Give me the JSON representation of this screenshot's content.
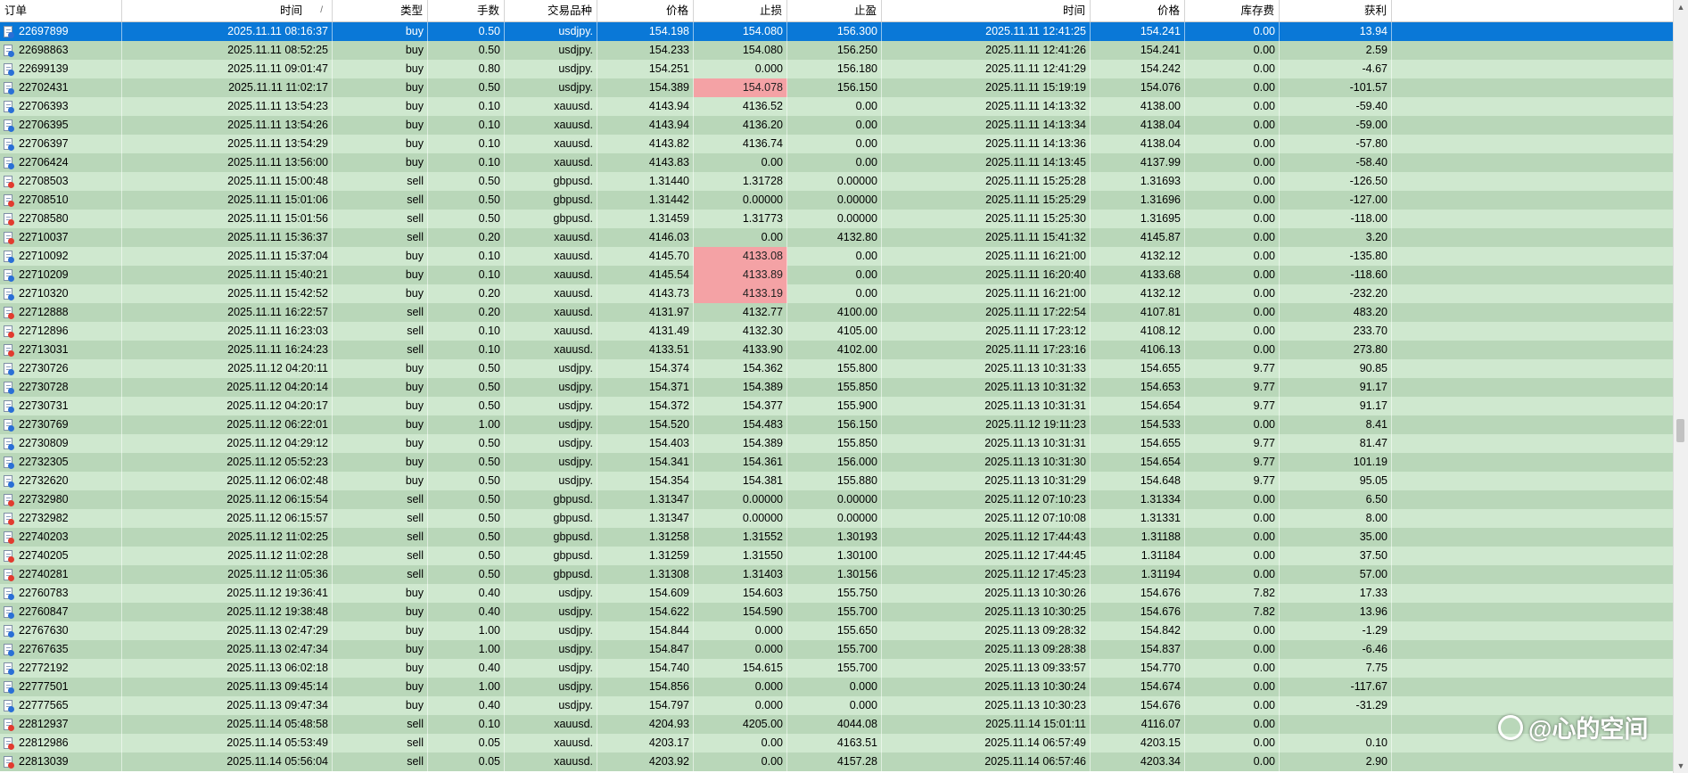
{
  "columns": [
    "订单",
    "时间",
    "类型",
    "手数",
    "交易品种",
    "价格",
    "止损",
    "止盈",
    "时间",
    "价格",
    "库存费",
    "获利"
  ],
  "sort_indicator": "/",
  "rows": [
    {
      "order": "22697899",
      "open_time": "2025.11.11 08:16:37",
      "type": "buy",
      "lots": "0.50",
      "symbol": "usdjpy.",
      "open_price": "154.198",
      "sl": "154.080",
      "tp": "156.300",
      "close_time": "2025.11.11 12:41:25",
      "close_price": "154.241",
      "swap": "0.00",
      "profit": "13.94",
      "selected": true
    },
    {
      "order": "22698863",
      "open_time": "2025.11.11 08:52:25",
      "type": "buy",
      "lots": "0.50",
      "symbol": "usdjpy.",
      "open_price": "154.233",
      "sl": "154.080",
      "tp": "156.250",
      "close_time": "2025.11.11 12:41:26",
      "close_price": "154.241",
      "swap": "0.00",
      "profit": "2.59"
    },
    {
      "order": "22699139",
      "open_time": "2025.11.11 09:01:47",
      "type": "buy",
      "lots": "0.80",
      "symbol": "usdjpy.",
      "open_price": "154.251",
      "sl": "0.000",
      "tp": "156.180",
      "close_time": "2025.11.11 12:41:29",
      "close_price": "154.242",
      "swap": "0.00",
      "profit": "-4.67"
    },
    {
      "order": "22702431",
      "open_time": "2025.11.11 11:02:17",
      "type": "buy",
      "lots": "0.50",
      "symbol": "usdjpy.",
      "open_price": "154.389",
      "sl": "154.078",
      "tp": "156.150",
      "close_time": "2025.11.11 15:19:19",
      "close_price": "154.076",
      "swap": "0.00",
      "profit": "-101.57",
      "sl_hit": true
    },
    {
      "order": "22706393",
      "open_time": "2025.11.11 13:54:23",
      "type": "buy",
      "lots": "0.10",
      "symbol": "xauusd.",
      "open_price": "4143.94",
      "sl": "4136.52",
      "tp": "0.00",
      "close_time": "2025.11.11 14:13:32",
      "close_price": "4138.00",
      "swap": "0.00",
      "profit": "-59.40"
    },
    {
      "order": "22706395",
      "open_time": "2025.11.11 13:54:26",
      "type": "buy",
      "lots": "0.10",
      "symbol": "xauusd.",
      "open_price": "4143.94",
      "sl": "4136.20",
      "tp": "0.00",
      "close_time": "2025.11.11 14:13:34",
      "close_price": "4138.04",
      "swap": "0.00",
      "profit": "-59.00"
    },
    {
      "order": "22706397",
      "open_time": "2025.11.11 13:54:29",
      "type": "buy",
      "lots": "0.10",
      "symbol": "xauusd.",
      "open_price": "4143.82",
      "sl": "4136.74",
      "tp": "0.00",
      "close_time": "2025.11.11 14:13:36",
      "close_price": "4138.04",
      "swap": "0.00",
      "profit": "-57.80"
    },
    {
      "order": "22706424",
      "open_time": "2025.11.11 13:56:00",
      "type": "buy",
      "lots": "0.10",
      "symbol": "xauusd.",
      "open_price": "4143.83",
      "sl": "0.00",
      "tp": "0.00",
      "close_time": "2025.11.11 14:13:45",
      "close_price": "4137.99",
      "swap": "0.00",
      "profit": "-58.40"
    },
    {
      "order": "22708503",
      "open_time": "2025.11.11 15:00:48",
      "type": "sell",
      "lots": "0.50",
      "symbol": "gbpusd.",
      "open_price": "1.31440",
      "sl": "1.31728",
      "tp": "0.00000",
      "close_time": "2025.11.11 15:25:28",
      "close_price": "1.31693",
      "swap": "0.00",
      "profit": "-126.50"
    },
    {
      "order": "22708510",
      "open_time": "2025.11.11 15:01:06",
      "type": "sell",
      "lots": "0.50",
      "symbol": "gbpusd.",
      "open_price": "1.31442",
      "sl": "0.00000",
      "tp": "0.00000",
      "close_time": "2025.11.11 15:25:29",
      "close_price": "1.31696",
      "swap": "0.00",
      "profit": "-127.00"
    },
    {
      "order": "22708580",
      "open_time": "2025.11.11 15:01:56",
      "type": "sell",
      "lots": "0.50",
      "symbol": "gbpusd.",
      "open_price": "1.31459",
      "sl": "1.31773",
      "tp": "0.00000",
      "close_time": "2025.11.11 15:25:30",
      "close_price": "1.31695",
      "swap": "0.00",
      "profit": "-118.00"
    },
    {
      "order": "22710037",
      "open_time": "2025.11.11 15:36:37",
      "type": "sell",
      "lots": "0.20",
      "symbol": "xauusd.",
      "open_price": "4146.03",
      "sl": "0.00",
      "tp": "4132.80",
      "close_time": "2025.11.11 15:41:32",
      "close_price": "4145.87",
      "swap": "0.00",
      "profit": "3.20"
    },
    {
      "order": "22710092",
      "open_time": "2025.11.11 15:37:04",
      "type": "buy",
      "lots": "0.10",
      "symbol": "xauusd.",
      "open_price": "4145.70",
      "sl": "4133.08",
      "tp": "0.00",
      "close_time": "2025.11.11 16:21:00",
      "close_price": "4132.12",
      "swap": "0.00",
      "profit": "-135.80",
      "sl_hit": true
    },
    {
      "order": "22710209",
      "open_time": "2025.11.11 15:40:21",
      "type": "buy",
      "lots": "0.10",
      "symbol": "xauusd.",
      "open_price": "4145.54",
      "sl": "4133.89",
      "tp": "0.00",
      "close_time": "2025.11.11 16:20:40",
      "close_price": "4133.68",
      "swap": "0.00",
      "profit": "-118.60",
      "sl_hit": true
    },
    {
      "order": "22710320",
      "open_time": "2025.11.11 15:42:52",
      "type": "buy",
      "lots": "0.20",
      "symbol": "xauusd.",
      "open_price": "4143.73",
      "sl": "4133.19",
      "tp": "0.00",
      "close_time": "2025.11.11 16:21:00",
      "close_price": "4132.12",
      "swap": "0.00",
      "profit": "-232.20",
      "sl_hit": true
    },
    {
      "order": "22712888",
      "open_time": "2025.11.11 16:22:57",
      "type": "sell",
      "lots": "0.20",
      "symbol": "xauusd.",
      "open_price": "4131.97",
      "sl": "4132.77",
      "tp": "4100.00",
      "close_time": "2025.11.11 17:22:54",
      "close_price": "4107.81",
      "swap": "0.00",
      "profit": "483.20"
    },
    {
      "order": "22712896",
      "open_time": "2025.11.11 16:23:03",
      "type": "sell",
      "lots": "0.10",
      "symbol": "xauusd.",
      "open_price": "4131.49",
      "sl": "4132.30",
      "tp": "4105.00",
      "close_time": "2025.11.11 17:23:12",
      "close_price": "4108.12",
      "swap": "0.00",
      "profit": "233.70"
    },
    {
      "order": "22713031",
      "open_time": "2025.11.11 16:24:23",
      "type": "sell",
      "lots": "0.10",
      "symbol": "xauusd.",
      "open_price": "4133.51",
      "sl": "4133.90",
      "tp": "4102.00",
      "close_time": "2025.11.11 17:23:16",
      "close_price": "4106.13",
      "swap": "0.00",
      "profit": "273.80"
    },
    {
      "order": "22730726",
      "open_time": "2025.11.12 04:20:11",
      "type": "buy",
      "lots": "0.50",
      "symbol": "usdjpy.",
      "open_price": "154.374",
      "sl": "154.362",
      "tp": "155.800",
      "close_time": "2025.11.13 10:31:33",
      "close_price": "154.655",
      "swap": "9.77",
      "profit": "90.85"
    },
    {
      "order": "22730728",
      "open_time": "2025.11.12 04:20:14",
      "type": "buy",
      "lots": "0.50",
      "symbol": "usdjpy.",
      "open_price": "154.371",
      "sl": "154.389",
      "tp": "155.850",
      "close_time": "2025.11.13 10:31:32",
      "close_price": "154.653",
      "swap": "9.77",
      "profit": "91.17"
    },
    {
      "order": "22730731",
      "open_time": "2025.11.12 04:20:17",
      "type": "buy",
      "lots": "0.50",
      "symbol": "usdjpy.",
      "open_price": "154.372",
      "sl": "154.377",
      "tp": "155.900",
      "close_time": "2025.11.13 10:31:31",
      "close_price": "154.654",
      "swap": "9.77",
      "profit": "91.17"
    },
    {
      "order": "22730769",
      "open_time": "2025.11.12 06:22:01",
      "type": "buy",
      "lots": "1.00",
      "symbol": "usdjpy.",
      "open_price": "154.520",
      "sl": "154.483",
      "tp": "156.150",
      "close_time": "2025.11.12 19:11:23",
      "close_price": "154.533",
      "swap": "0.00",
      "profit": "8.41"
    },
    {
      "order": "22730809",
      "open_time": "2025.11.12 04:29:12",
      "type": "buy",
      "lots": "0.50",
      "symbol": "usdjpy.",
      "open_price": "154.403",
      "sl": "154.389",
      "tp": "155.850",
      "close_time": "2025.11.13 10:31:31",
      "close_price": "154.655",
      "swap": "9.77",
      "profit": "81.47"
    },
    {
      "order": "22732305",
      "open_time": "2025.11.12 05:52:23",
      "type": "buy",
      "lots": "0.50",
      "symbol": "usdjpy.",
      "open_price": "154.341",
      "sl": "154.361",
      "tp": "156.000",
      "close_time": "2025.11.13 10:31:30",
      "close_price": "154.654",
      "swap": "9.77",
      "profit": "101.19"
    },
    {
      "order": "22732620",
      "open_time": "2025.11.12 06:02:48",
      "type": "buy",
      "lots": "0.50",
      "symbol": "usdjpy.",
      "open_price": "154.354",
      "sl": "154.381",
      "tp": "155.880",
      "close_time": "2025.11.13 10:31:29",
      "close_price": "154.648",
      "swap": "9.77",
      "profit": "95.05"
    },
    {
      "order": "22732980",
      "open_time": "2025.11.12 06:15:54",
      "type": "sell",
      "lots": "0.50",
      "symbol": "gbpusd.",
      "open_price": "1.31347",
      "sl": "0.00000",
      "tp": "0.00000",
      "close_time": "2025.11.12 07:10:23",
      "close_price": "1.31334",
      "swap": "0.00",
      "profit": "6.50"
    },
    {
      "order": "22732982",
      "open_time": "2025.11.12 06:15:57",
      "type": "sell",
      "lots": "0.50",
      "symbol": "gbpusd.",
      "open_price": "1.31347",
      "sl": "0.00000",
      "tp": "0.00000",
      "close_time": "2025.11.12 07:10:08",
      "close_price": "1.31331",
      "swap": "0.00",
      "profit": "8.00"
    },
    {
      "order": "22740203",
      "open_time": "2025.11.12 11:02:25",
      "type": "sell",
      "lots": "0.50",
      "symbol": "gbpusd.",
      "open_price": "1.31258",
      "sl": "1.31552",
      "tp": "1.30193",
      "close_time": "2025.11.12 17:44:43",
      "close_price": "1.31188",
      "swap": "0.00",
      "profit": "35.00"
    },
    {
      "order": "22740205",
      "open_time": "2025.11.12 11:02:28",
      "type": "sell",
      "lots": "0.50",
      "symbol": "gbpusd.",
      "open_price": "1.31259",
      "sl": "1.31550",
      "tp": "1.30100",
      "close_time": "2025.11.12 17:44:45",
      "close_price": "1.31184",
      "swap": "0.00",
      "profit": "37.50"
    },
    {
      "order": "22740281",
      "open_time": "2025.11.12 11:05:36",
      "type": "sell",
      "lots": "0.50",
      "symbol": "gbpusd.",
      "open_price": "1.31308",
      "sl": "1.31403",
      "tp": "1.30156",
      "close_time": "2025.11.12 17:45:23",
      "close_price": "1.31194",
      "swap": "0.00",
      "profit": "57.00"
    },
    {
      "order": "22760783",
      "open_time": "2025.11.12 19:36:41",
      "type": "buy",
      "lots": "0.40",
      "symbol": "usdjpy.",
      "open_price": "154.609",
      "sl": "154.603",
      "tp": "155.750",
      "close_time": "2025.11.13 10:30:26",
      "close_price": "154.676",
      "swap": "7.82",
      "profit": "17.33"
    },
    {
      "order": "22760847",
      "open_time": "2025.11.12 19:38:48",
      "type": "buy",
      "lots": "0.40",
      "symbol": "usdjpy.",
      "open_price": "154.622",
      "sl": "154.590",
      "tp": "155.700",
      "close_time": "2025.11.13 10:30:25",
      "close_price": "154.676",
      "swap": "7.82",
      "profit": "13.96"
    },
    {
      "order": "22767630",
      "open_time": "2025.11.13 02:47:29",
      "type": "buy",
      "lots": "1.00",
      "symbol": "usdjpy.",
      "open_price": "154.844",
      "sl": "0.000",
      "tp": "155.650",
      "close_time": "2025.11.13 09:28:32",
      "close_price": "154.842",
      "swap": "0.00",
      "profit": "-1.29"
    },
    {
      "order": "22767635",
      "open_time": "2025.11.13 02:47:34",
      "type": "buy",
      "lots": "1.00",
      "symbol": "usdjpy.",
      "open_price": "154.847",
      "sl": "0.000",
      "tp": "155.700",
      "close_time": "2025.11.13 09:28:38",
      "close_price": "154.837",
      "swap": "0.00",
      "profit": "-6.46"
    },
    {
      "order": "22772192",
      "open_time": "2025.11.13 06:02:18",
      "type": "buy",
      "lots": "0.40",
      "symbol": "usdjpy.",
      "open_price": "154.740",
      "sl": "154.615",
      "tp": "155.700",
      "close_time": "2025.11.13 09:33:57",
      "close_price": "154.770",
      "swap": "0.00",
      "profit": "7.75"
    },
    {
      "order": "22777501",
      "open_time": "2025.11.13 09:45:14",
      "type": "buy",
      "lots": "1.00",
      "symbol": "usdjpy.",
      "open_price": "154.856",
      "sl": "0.000",
      "tp": "0.000",
      "close_time": "2025.11.13 10:30:24",
      "close_price": "154.674",
      "swap": "0.00",
      "profit": "-117.67"
    },
    {
      "order": "22777565",
      "open_time": "2025.11.13 09:47:34",
      "type": "buy",
      "lots": "0.40",
      "symbol": "usdjpy.",
      "open_price": "154.797",
      "sl": "0.000",
      "tp": "0.000",
      "close_time": "2025.11.13 10:30:23",
      "close_price": "154.676",
      "swap": "0.00",
      "profit": "-31.29"
    },
    {
      "order": "22812937",
      "open_time": "2025.11.14 05:48:58",
      "type": "sell",
      "lots": "0.10",
      "symbol": "xauusd.",
      "open_price": "4204.93",
      "sl": "4205.00",
      "tp": "4044.08",
      "close_time": "2025.11.14 15:01:11",
      "close_price": "4116.07",
      "swap": "0.00",
      "profit": ""
    },
    {
      "order": "22812986",
      "open_time": "2025.11.14 05:53:49",
      "type": "sell",
      "lots": "0.05",
      "symbol": "xauusd.",
      "open_price": "4203.17",
      "sl": "0.00",
      "tp": "4163.51",
      "close_time": "2025.11.14 06:57:49",
      "close_price": "4203.15",
      "swap": "0.00",
      "profit": "0.10"
    },
    {
      "order": "22813039",
      "open_time": "2025.11.14 05:56:04",
      "type": "sell",
      "lots": "0.05",
      "symbol": "xauusd.",
      "open_price": "4203.92",
      "sl": "0.00",
      "tp": "4157.28",
      "close_time": "2025.11.14 06:57:46",
      "close_price": "4203.34",
      "swap": "0.00",
      "profit": "2.90"
    }
  ],
  "watermark": "@心的空间",
  "colors": {
    "selected_row": "#0a78d7",
    "row_even": "#cfe8cf",
    "row_odd": "#b9d7b9",
    "sl_highlight": "#f4a2a5"
  },
  "icons": {
    "row": "ticket-doc-icon",
    "scroll_up": "scroll-up-arrow-icon",
    "scroll_down": "scroll-down-arrow-icon"
  }
}
